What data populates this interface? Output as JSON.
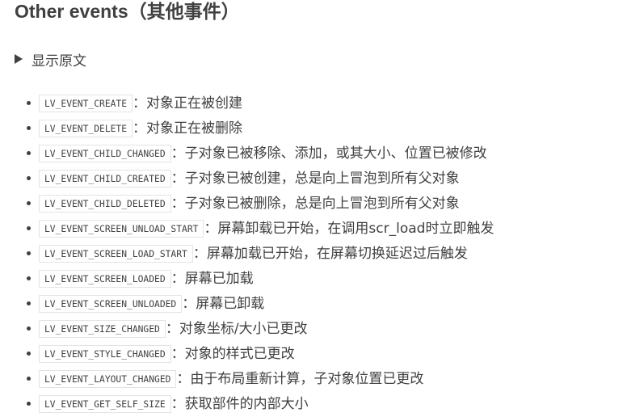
{
  "title": "Other events（其他事件）",
  "details": {
    "label": "显示原文"
  },
  "events": [
    {
      "code": "LV_EVENT_CREATE",
      "desc": "：对象正在被创建"
    },
    {
      "code": "LV_EVENT_DELETE",
      "desc": "：对象正在被删除"
    },
    {
      "code": "LV_EVENT_CHILD_CHANGED",
      "desc": "：子对象已被移除、添加，或其大小、位置已被修改"
    },
    {
      "code": "LV_EVENT_CHILD_CREATED",
      "desc": "：子对象已被创建，总是向上冒泡到所有父对象"
    },
    {
      "code": "LV_EVENT_CHILD_DELETED",
      "desc": "：子对象已被删除，总是向上冒泡到所有父对象"
    },
    {
      "code": "LV_EVENT_SCREEN_UNLOAD_START",
      "desc": "：屏幕卸载已开始，在调用scr_load时立即触发"
    },
    {
      "code": "LV_EVENT_SCREEN_LOAD_START",
      "desc": "：屏幕加载已开始，在屏幕切换延迟过后触发"
    },
    {
      "code": "LV_EVENT_SCREEN_LOADED",
      "desc": "：屏幕已加载"
    },
    {
      "code": "LV_EVENT_SCREEN_UNLOADED",
      "desc": "：屏幕已卸载"
    },
    {
      "code": "LV_EVENT_SIZE_CHANGED",
      "desc": "：对象坐标/大小已更改"
    },
    {
      "code": "LV_EVENT_STYLE_CHANGED",
      "desc": "：对象的样式已更改"
    },
    {
      "code": "LV_EVENT_LAYOUT_CHANGED",
      "desc": "：由于布局重新计算，子对象位置已更改"
    },
    {
      "code": "LV_EVENT_GET_SELF_SIZE",
      "desc": "：获取部件的内部大小"
    }
  ]
}
